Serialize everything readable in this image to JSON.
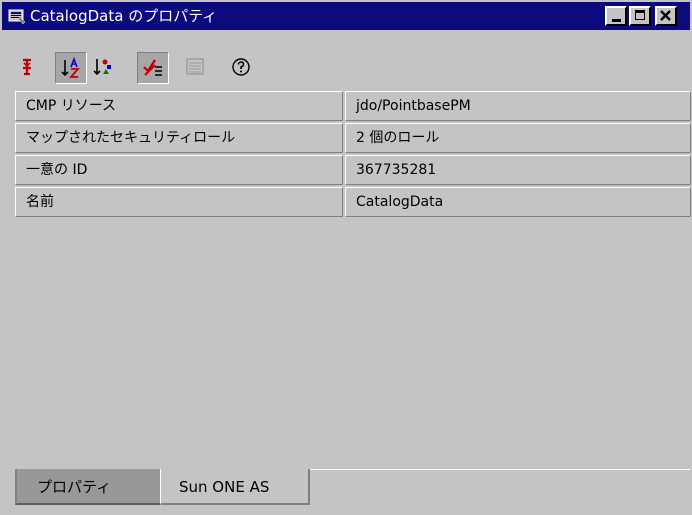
{
  "window": {
    "title": "CatalogData のプロパティ",
    "title_bg": "#0b0b7d",
    "buttons": [
      "minimize-icon",
      "maximize-icon",
      "close-icon"
    ]
  },
  "toolbar": {
    "items": [
      {
        "icon": "unsorted-icon",
        "pressed": false
      },
      {
        "icon": "sort-by-name-icon",
        "pressed": true
      },
      {
        "icon": "sort-by-type-icon",
        "pressed": false
      },
      {
        "icon": "show-editable-only-icon",
        "pressed": true
      },
      {
        "icon": "customizer-icon",
        "pressed": false,
        "disabled": true
      },
      {
        "icon": "help-icon",
        "pressed": false
      }
    ]
  },
  "properties": [
    {
      "name": "CMP リソース",
      "value": "jdo/PointbasePM"
    },
    {
      "name": "マップされたセキュリティロール",
      "value": "2 個のロール"
    },
    {
      "name": "一意の ID",
      "value": "367735281"
    },
    {
      "name": "名前",
      "value": "CatalogData"
    }
  ],
  "tabs": [
    {
      "label": "プロパティ",
      "selected": true
    },
    {
      "label": "Sun ONE AS",
      "selected": false
    }
  ]
}
